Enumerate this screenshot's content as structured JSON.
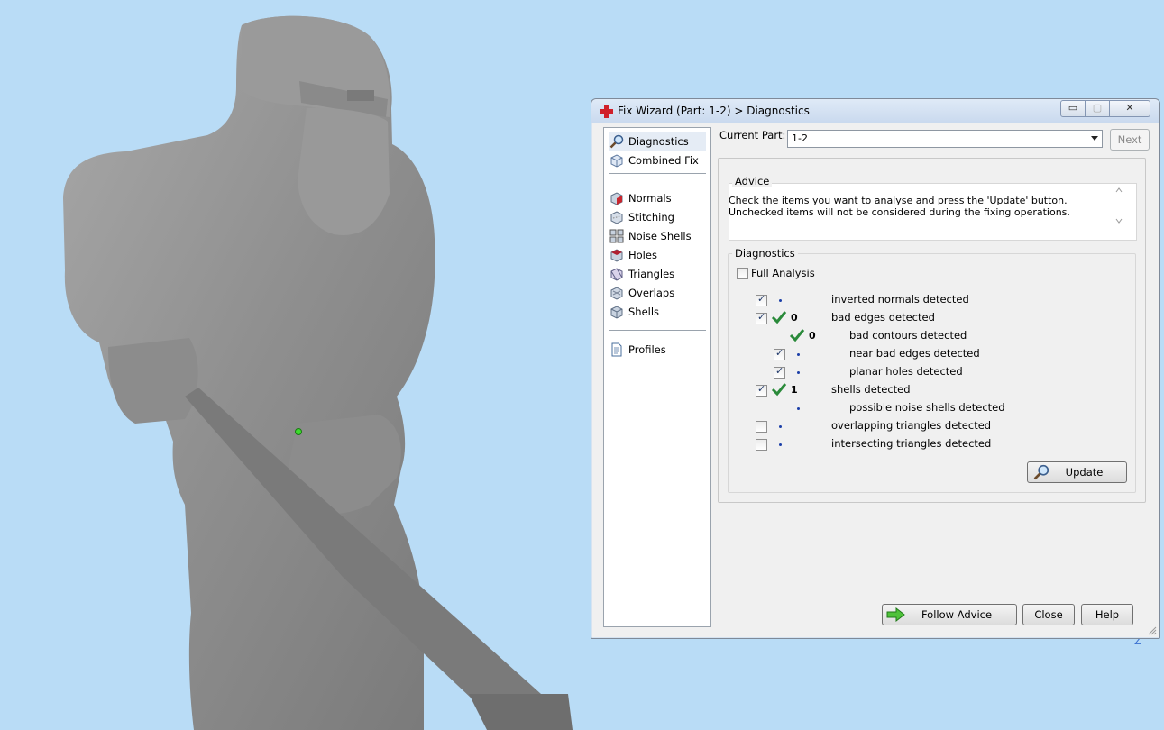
{
  "window": {
    "title": "Fix Wizard (Part: 1-2) > Diagnostics",
    "controls": {
      "minimize": "▭",
      "maximize": "▢",
      "close": "✕"
    }
  },
  "nav": {
    "items": [
      {
        "label": "Diagnostics",
        "icon": "magnifier-icon",
        "selected": true
      },
      {
        "label": "Combined Fix",
        "icon": "cube-icon"
      },
      {
        "label": "Normals",
        "icon": "normals-cube-icon"
      },
      {
        "label": "Stitching",
        "icon": "stitching-cube-icon"
      },
      {
        "label": "Noise Shells",
        "icon": "noise-shells-icon"
      },
      {
        "label": "Holes",
        "icon": "holes-cube-icon"
      },
      {
        "label": "Triangles",
        "icon": "triangles-cube-icon"
      },
      {
        "label": "Overlaps",
        "icon": "overlaps-cube-icon"
      },
      {
        "label": "Shells",
        "icon": "shells-cube-icon"
      },
      {
        "label": "Profiles",
        "icon": "document-icon"
      }
    ]
  },
  "current_part": {
    "label": "Current Part:",
    "value": "1-2",
    "next_label": "Next"
  },
  "advice": {
    "title": "Advice",
    "text": "Check the items you want to analyse and press the 'Update' button. Unchecked items will not be considered during the fixing operations."
  },
  "diagnostics": {
    "title": "Diagnostics",
    "full_analysis_label": "Full Analysis",
    "full_analysis_checked": false,
    "rows": [
      {
        "label": "inverted normals detected",
        "checked": true,
        "count": "",
        "ok": false
      },
      {
        "label": "bad edges detected",
        "checked": true,
        "count": "0",
        "ok": true
      },
      {
        "label": "bad contours detected",
        "checked": null,
        "count": "0",
        "ok": true
      },
      {
        "label": "near bad edges detected",
        "checked": true,
        "count": "",
        "ok": false
      },
      {
        "label": "planar holes detected",
        "checked": true,
        "count": "",
        "ok": false
      },
      {
        "label": "shells detected",
        "checked": true,
        "count": "1",
        "ok": true
      },
      {
        "label": "possible noise shells detected",
        "checked": null,
        "count": "",
        "ok": false
      },
      {
        "label": "overlapping triangles detected",
        "checked": false,
        "count": "",
        "ok": false
      },
      {
        "label": "intersecting triangles detected",
        "checked": false,
        "count": "",
        "ok": false
      }
    ],
    "update_label": "Update"
  },
  "footer": {
    "follow_label": "Follow Advice",
    "close_label": "Close",
    "help_label": "Help"
  },
  "viewport": {
    "axis_label": "Z",
    "background": "#b9dcf6"
  }
}
